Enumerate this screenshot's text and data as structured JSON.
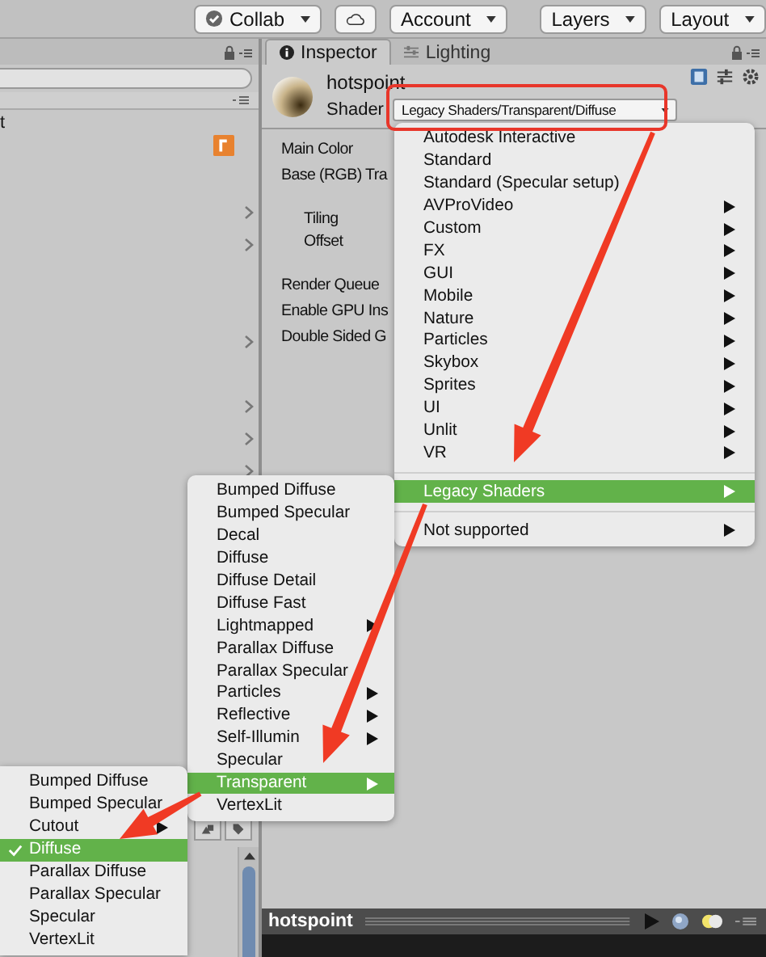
{
  "toolbar": [
    {
      "kind": "collab",
      "label": "Collab"
    },
    {
      "kind": "cloud"
    },
    {
      "kind": "dropdown",
      "label": "Account"
    },
    {
      "kind": "dropdown",
      "label": "Layers"
    },
    {
      "kind": "dropdown",
      "label": "Layout"
    }
  ],
  "hierarchy": {
    "text": "t",
    "rows": [
      {
        "expandable": true
      },
      {
        "expandable": true
      },
      {
        "expandable": false
      },
      {
        "expandable": false
      },
      {
        "expandable": true
      },
      {
        "expandable": false
      },
      {
        "expandable": true
      },
      {
        "expandable": true
      },
      {
        "expandable": true
      }
    ]
  },
  "tabs": [
    {
      "label": "Inspector",
      "selected": true
    },
    {
      "label": "Lighting",
      "selected": false
    }
  ],
  "material": {
    "name": "hotspoint",
    "shader_label": "Shader",
    "shader_value": "Legacy Shaders/Transparent/Diffuse"
  },
  "property_groups": [
    {
      "kind": "plain",
      "rows": [
        "Main Color",
        "Base (RGB) Tra"
      ]
    },
    {
      "kind": "indented",
      "rows": [
        "Tiling",
        "Offset"
      ]
    },
    {
      "kind": "plain",
      "rows": [
        "Render Queue",
        "Enable GPU Ins",
        "Double Sided G"
      ]
    }
  ],
  "shader_menu": {
    "items": [
      {
        "kind": "item",
        "label": "Autodesk Interactive",
        "submenu": false,
        "selected": false
      },
      {
        "kind": "item",
        "label": "Standard",
        "submenu": false,
        "selected": false
      },
      {
        "kind": "item",
        "label": "Standard (Specular setup)",
        "submenu": false,
        "selected": false
      },
      {
        "kind": "item",
        "label": "AVProVideo",
        "submenu": true,
        "selected": false
      },
      {
        "kind": "item",
        "label": "Custom",
        "submenu": true,
        "selected": false
      },
      {
        "kind": "item",
        "label": "FX",
        "submenu": true,
        "selected": false
      },
      {
        "kind": "item",
        "label": "GUI",
        "submenu": true,
        "selected": false
      },
      {
        "kind": "item",
        "label": "Mobile",
        "submenu": true,
        "selected": false
      },
      {
        "kind": "item",
        "label": "Nature",
        "submenu": true,
        "selected": false
      },
      {
        "kind": "item",
        "label": "Particles",
        "submenu": true,
        "selected": false
      },
      {
        "kind": "item",
        "label": "Skybox",
        "submenu": true,
        "selected": false
      },
      {
        "kind": "item",
        "label": "Sprites",
        "submenu": true,
        "selected": false
      },
      {
        "kind": "item",
        "label": "UI",
        "submenu": true,
        "selected": false
      },
      {
        "kind": "item",
        "label": "Unlit",
        "submenu": true,
        "selected": false
      },
      {
        "kind": "item",
        "label": "VR",
        "submenu": true,
        "selected": false
      },
      {
        "kind": "separator"
      },
      {
        "kind": "item",
        "label": "Legacy Shaders",
        "submenu": true,
        "selected": true
      },
      {
        "kind": "separator"
      },
      {
        "kind": "item",
        "label": "Not supported",
        "submenu": true,
        "selected": false
      }
    ]
  },
  "legacy_menu": {
    "items": [
      {
        "kind": "item",
        "label": "Bumped Diffuse",
        "submenu": false,
        "selected": false
      },
      {
        "kind": "item",
        "label": "Bumped Specular",
        "submenu": false,
        "selected": false
      },
      {
        "kind": "item",
        "label": "Decal",
        "submenu": false,
        "selected": false
      },
      {
        "kind": "item",
        "label": "Diffuse",
        "submenu": false,
        "selected": false
      },
      {
        "kind": "item",
        "label": "Diffuse Detail",
        "submenu": false,
        "selected": false
      },
      {
        "kind": "item",
        "label": "Diffuse Fast",
        "submenu": false,
        "selected": false
      },
      {
        "kind": "item",
        "label": "Lightmapped",
        "submenu": true,
        "selected": false
      },
      {
        "kind": "item",
        "label": "Parallax Diffuse",
        "submenu": false,
        "selected": false
      },
      {
        "kind": "item",
        "label": "Parallax Specular",
        "submenu": false,
        "selected": false
      },
      {
        "kind": "item",
        "label": "Particles",
        "submenu": true,
        "selected": false
      },
      {
        "kind": "item",
        "label": "Reflective",
        "submenu": true,
        "selected": false
      },
      {
        "kind": "item",
        "label": "Self-Illumin",
        "submenu": true,
        "selected": false
      },
      {
        "kind": "item",
        "label": "Specular",
        "submenu": false,
        "selected": false
      },
      {
        "kind": "item",
        "label": "Transparent",
        "submenu": true,
        "selected": true
      },
      {
        "kind": "item",
        "label": "VertexLit",
        "submenu": false,
        "selected": false
      }
    ]
  },
  "transparent_menu": {
    "items": [
      {
        "kind": "item",
        "label": "Bumped Diffuse",
        "submenu": false,
        "selected": false,
        "checked": false
      },
      {
        "kind": "item",
        "label": "Bumped Specular",
        "submenu": false,
        "selected": false,
        "checked": false
      },
      {
        "kind": "item",
        "label": "Cutout",
        "submenu": true,
        "selected": false,
        "checked": false
      },
      {
        "kind": "item",
        "label": "Diffuse",
        "submenu": false,
        "selected": true,
        "checked": true
      },
      {
        "kind": "item",
        "label": "Parallax Diffuse",
        "submenu": false,
        "selected": false,
        "checked": false
      },
      {
        "kind": "item",
        "label": "Parallax Specular",
        "submenu": false,
        "selected": false,
        "checked": false
      },
      {
        "kind": "item",
        "label": "Specular",
        "submenu": false,
        "selected": false,
        "checked": false
      },
      {
        "kind": "item",
        "label": "VertexLit",
        "submenu": false,
        "selected": false,
        "checked": false
      }
    ]
  },
  "preview": {
    "title": "hotspoint"
  }
}
